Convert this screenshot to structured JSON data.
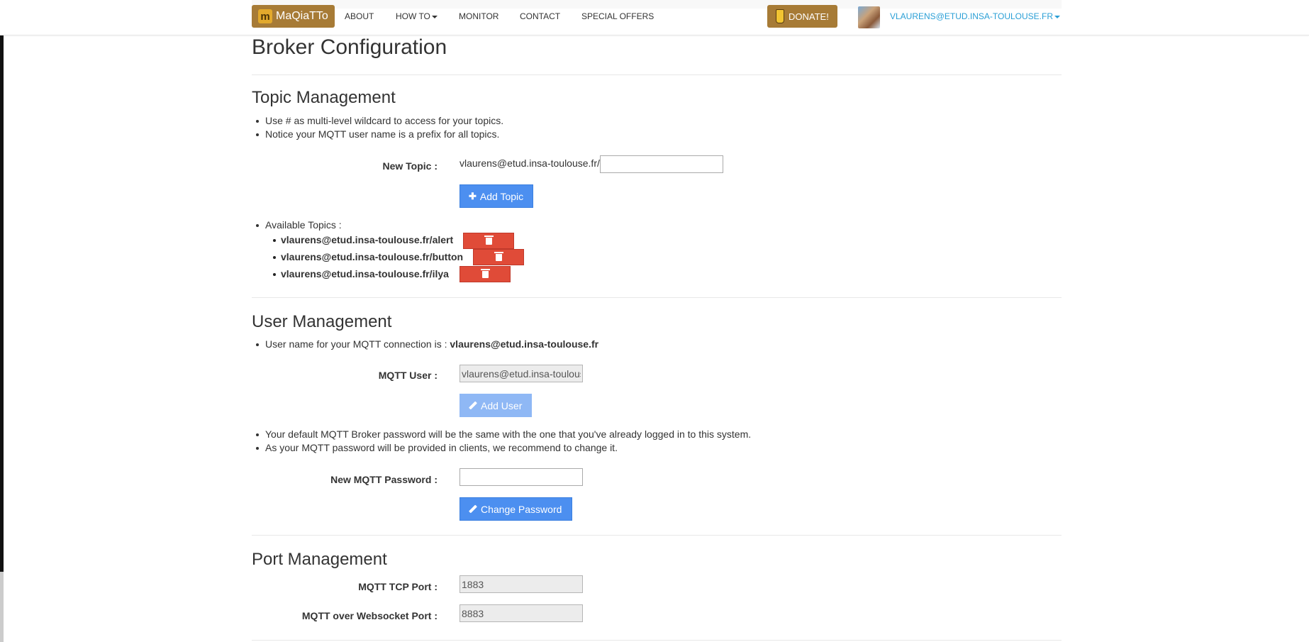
{
  "navbar": {
    "brand": "MaQiaTTo",
    "brand_logo_letter": "m",
    "items": [
      {
        "label": "ABOUT"
      },
      {
        "label": "HOW TO"
      },
      {
        "label": "MONITOR"
      },
      {
        "label": "CONTACT"
      },
      {
        "label": "SPECIAL OFFERS"
      }
    ],
    "donate": "DONATE!",
    "user": "VLAURENS@ETUD.INSA-TOULOUSE.FR"
  },
  "page": {
    "title": "Broker Configuration"
  },
  "topic_management": {
    "heading": "Topic Management",
    "notes": [
      "Use # as multi-level wildcard to access for your topics.",
      "Notice your MQTT user name is a prefix for all topics."
    ],
    "new_topic_label": "New Topic :",
    "prefix": "vlaurens@etud.insa-toulouse.fr/",
    "new_topic_value": "",
    "add_topic_button": "Add Topic",
    "available_label": "Available Topics :",
    "topics": [
      "vlaurens@etud.insa-toulouse.fr/alert",
      "vlaurens@etud.insa-toulouse.fr/button",
      "vlaurens@etud.insa-toulouse.fr/ilya"
    ]
  },
  "user_management": {
    "heading": "User Management",
    "note_prefix": "User name for your MQTT connection is : ",
    "note_user": "vlaurens@etud.insa-toulouse.fr",
    "mqtt_user_label": "MQTT User :",
    "mqtt_user_value": "vlaurens@etud.insa-toulouse.fr",
    "add_user_button": "Add User",
    "password_notes": [
      "Your default MQTT Broker password will be the same with the one that you've already logged in to this system.",
      "As your MQTT password will be provided in clients, we recommend to change it."
    ],
    "new_password_label": "New MQTT Password :",
    "new_password_value": "",
    "change_password_button": "Change Password"
  },
  "port_management": {
    "heading": "Port Management",
    "tcp_label": "MQTT TCP Port :",
    "tcp_value": "1883",
    "ws_label": "MQTT over Websocket Port :",
    "ws_value": "8883"
  },
  "colors": {
    "brand": "#a77b36",
    "primary_button": "#4c8ff0",
    "danger_button": "#e04b38",
    "link": "#2a9fd6"
  }
}
